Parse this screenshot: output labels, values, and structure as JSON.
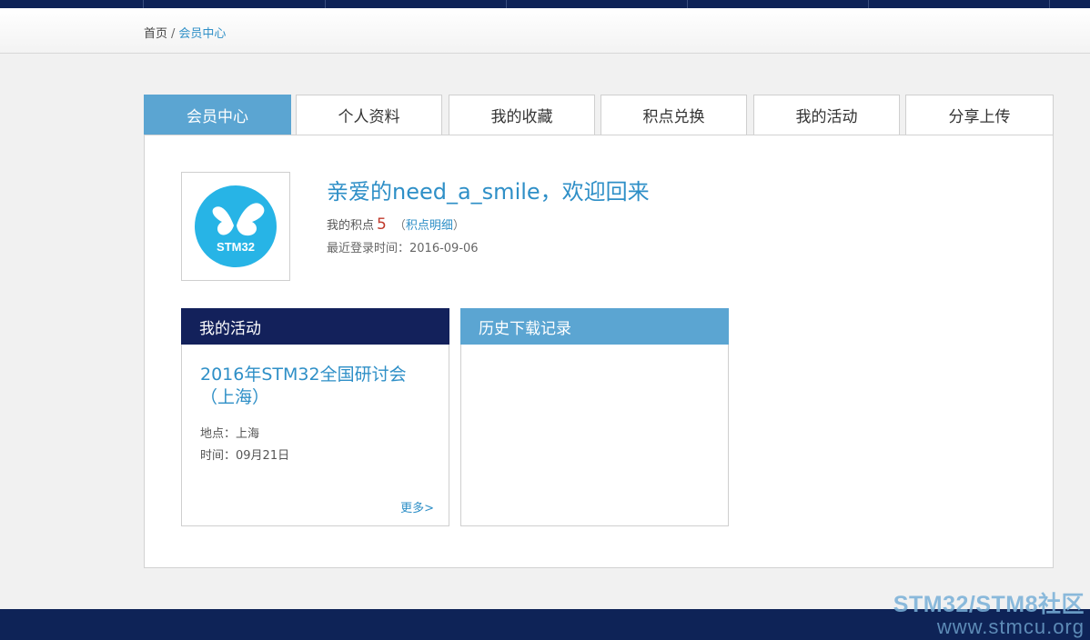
{
  "breadcrumb": {
    "home": "首页",
    "separator": "/",
    "current": "会员中心"
  },
  "tabs": [
    {
      "label": "会员中心",
      "active": true
    },
    {
      "label": "个人资料",
      "active": false
    },
    {
      "label": "我的收藏",
      "active": false
    },
    {
      "label": "积点兑换",
      "active": false
    },
    {
      "label": "我的活动",
      "active": false
    },
    {
      "label": "分享上传",
      "active": false
    }
  ],
  "profile": {
    "avatar_text": "STM32",
    "welcome": "亲爱的need_a_smile，欢迎回来",
    "points_label": "我的积点",
    "points_value": "5",
    "points_detail_open": "（",
    "points_detail_link": "积点明细",
    "points_detail_close": "）",
    "last_login": "最近登录时间：2016-09-06"
  },
  "activity_card": {
    "title": "我的活动",
    "event_title": "2016年STM32全国研讨会（上海）",
    "location": "地点：上海",
    "time": "时间：09月21日",
    "more": "更多>"
  },
  "history_card": {
    "title": "历史下载记录"
  },
  "watermark": {
    "line1": "STM32/STM8社区",
    "line2": "www.stmcu.org"
  },
  "colors": {
    "navy": "#0e2357",
    "accent_blue": "#5ba5d2",
    "link_blue": "#2e8fc7",
    "points_red": "#c0392b",
    "logo_blue": "#27b4e6"
  }
}
